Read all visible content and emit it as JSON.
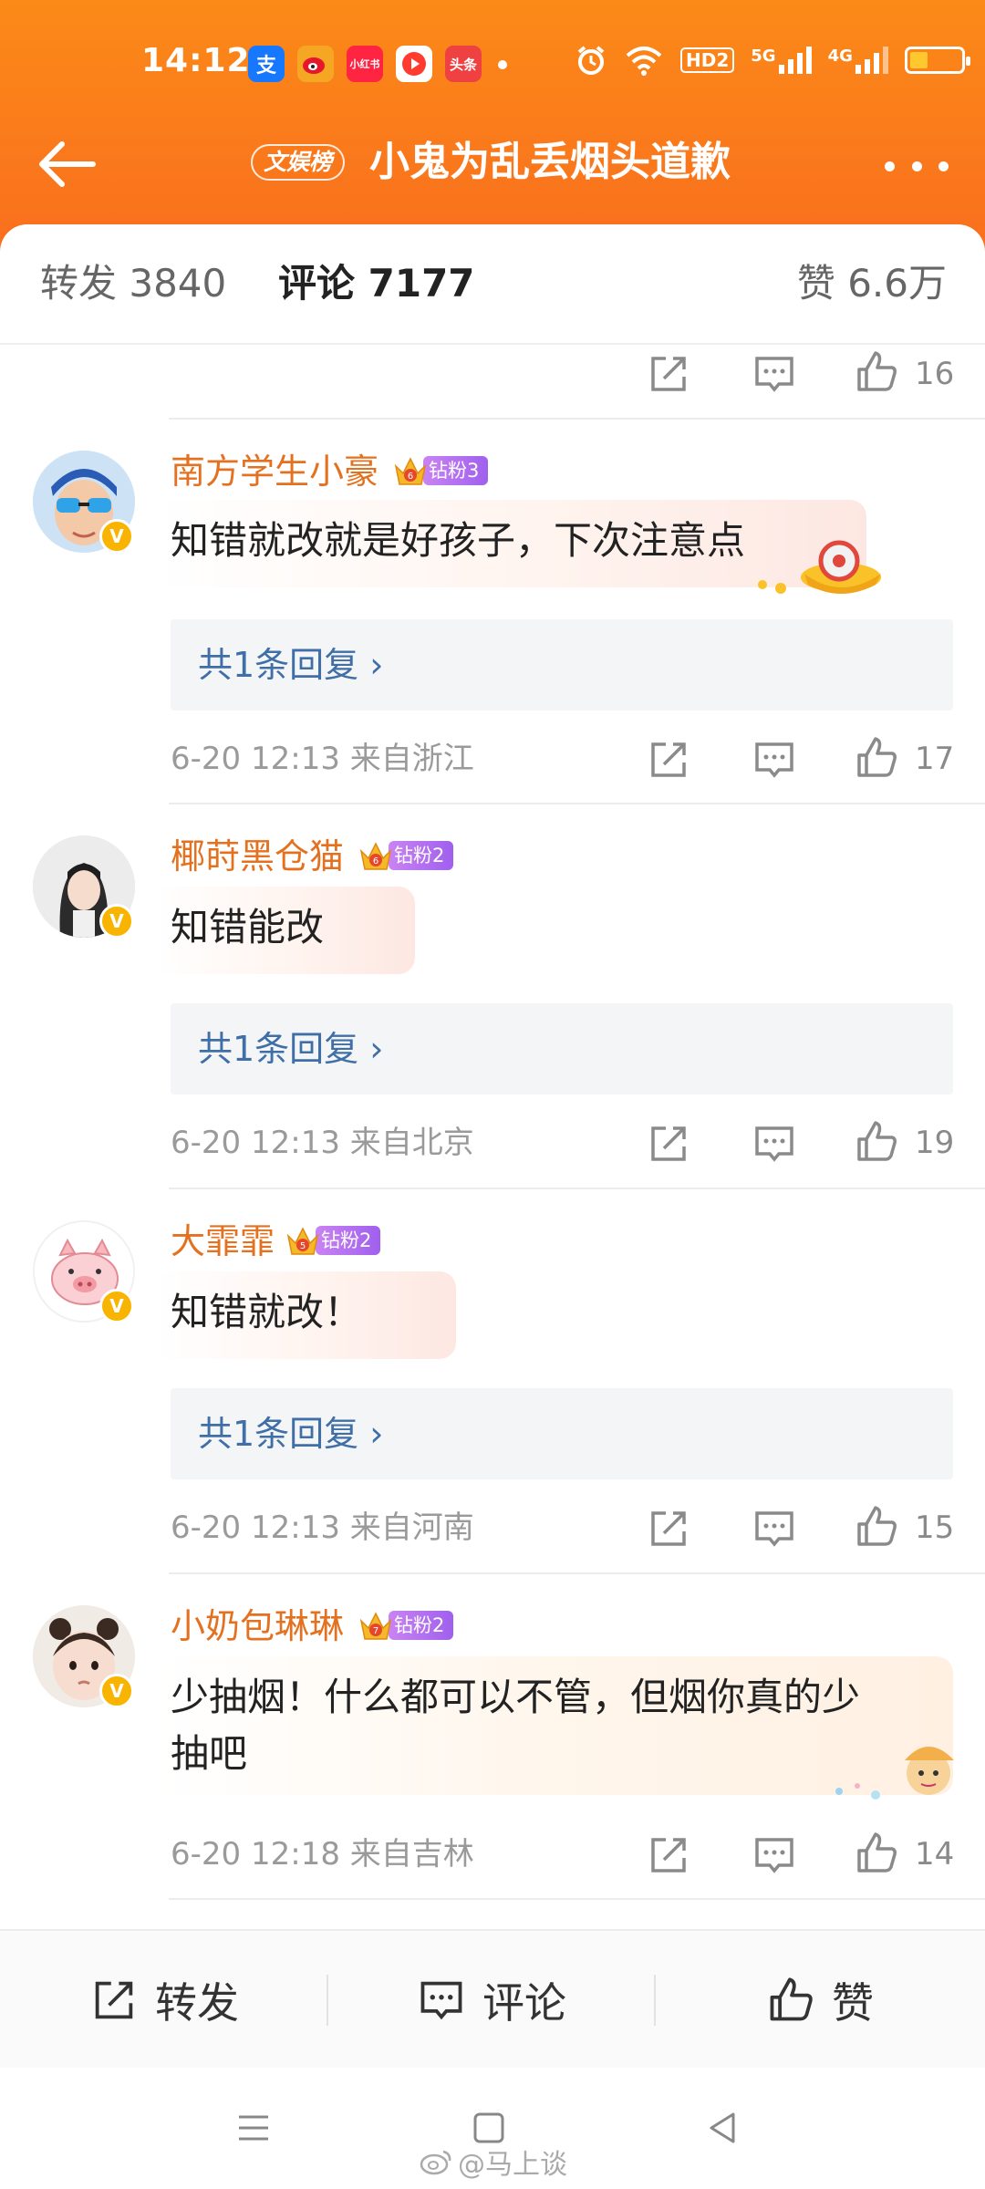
{
  "status_bar": {
    "time": "14:12",
    "apps": [
      "alipay-icon",
      "weibo-icon",
      "xiaohongshu-icon",
      "video-app-icon",
      "toutiao-icon"
    ],
    "app_labels": {
      "alipay": "支",
      "xiaohongshu": "小红书",
      "toutiao": "头条"
    },
    "network": [
      "HD2",
      "5G",
      "4G"
    ],
    "battery_level": 0.35
  },
  "header": {
    "tag": "文娱榜",
    "title": "小鬼为乱丢烟头道歉",
    "accent_color": "#fa7a1c"
  },
  "tabs": {
    "repost": "转发 3840",
    "comment": "评论 7177",
    "like": "赞 6.6万"
  },
  "previous_comment": {
    "likes": "16"
  },
  "comments": [
    {
      "username": "南方学生小豪",
      "fan_level": "6",
      "fan_badge": "钻粉3",
      "text": "知错就改就是好孩子，下次注意点",
      "reply_label": "共1条回复 ›",
      "time": "6-20 12:13",
      "location": "来自浙江",
      "likes": "17",
      "avatar_icon": "boy-sunglasses-avatar"
    },
    {
      "username": "椰莳黑仓猫",
      "fan_level": "6",
      "fan_badge": "钻粉2",
      "text": "知错能改",
      "reply_label": "共1条回复 ›",
      "time": "6-20 12:13",
      "location": "来自北京",
      "likes": "19",
      "avatar_icon": "girl-avatar"
    },
    {
      "username": "大霏霏",
      "fan_level": "5",
      "fan_badge": "钻粉2",
      "text": "知错就改！",
      "reply_label": "共1条回复 ›",
      "time": "6-20 12:13",
      "location": "来自河南",
      "likes": "15",
      "avatar_icon": "pig-avatar"
    },
    {
      "username": "小奶包琳琳",
      "fan_level": "7",
      "fan_badge": "钻粉2",
      "text_line1": "少抽烟！什么都可以不管，但烟你真的少",
      "text_line2": "抽吧",
      "time": "6-20 12:18",
      "location": "来自吉林",
      "likes": "14",
      "avatar_icon": "toddler-avatar"
    }
  ],
  "bottom_bar": {
    "repost": "转发",
    "comment": "评论",
    "like": "赞"
  },
  "watermark": "@马上谈"
}
